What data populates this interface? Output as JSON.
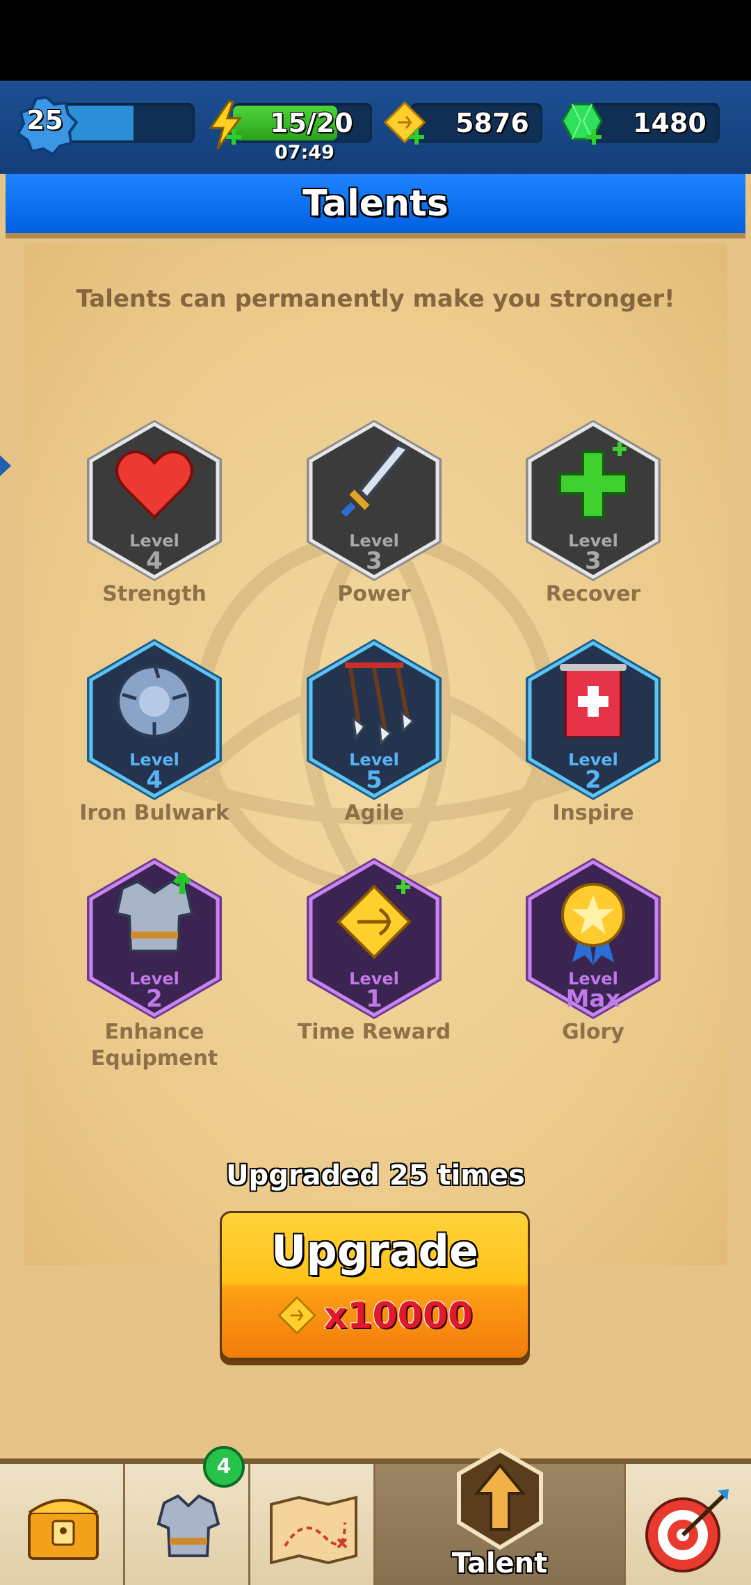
{
  "header": {
    "player_level": "25",
    "xp_fill": 0.58,
    "energy": "15/20",
    "energy_fill": 0.75,
    "energy_timer": "07:49",
    "gold": "5876",
    "gems": "1480"
  },
  "title": "Talents",
  "subtitle": "Talents can permanently make you stronger!",
  "talents": [
    {
      "name": "Strength",
      "level_label": "Level",
      "level": "4",
      "tier": "gray",
      "icon": "heart-icon"
    },
    {
      "name": "Power",
      "level_label": "Level",
      "level": "3",
      "tier": "gray",
      "icon": "sword-icon"
    },
    {
      "name": "Recover",
      "level_label": "Level",
      "level": "3",
      "tier": "gray",
      "icon": "plus-icon"
    },
    {
      "name": "Iron Bulwark",
      "level_label": "Level",
      "level": "4",
      "tier": "blue",
      "icon": "shield-icon"
    },
    {
      "name": "Agile",
      "level_label": "Level",
      "level": "5",
      "tier": "blue",
      "icon": "arrows-icon"
    },
    {
      "name": "Inspire",
      "level_label": "Level",
      "level": "2",
      "tier": "blue",
      "icon": "banner-icon"
    },
    {
      "name": "Enhance Equipment",
      "name_line1": "Enhance",
      "name_line2": "Equipment",
      "level_label": "Level",
      "level": "2",
      "tier": "purple",
      "icon": "armor-icon"
    },
    {
      "name": "Time Reward",
      "level_label": "Level",
      "level": "1",
      "tier": "purple",
      "icon": "gold-coin-icon"
    },
    {
      "name": "Glory",
      "level_label": "Level",
      "level": "Max",
      "tier": "purple",
      "icon": "medal-icon"
    }
  ],
  "upgrade": {
    "count_text": "Upgraded 25 times",
    "button_label": "Upgrade",
    "cost": "x10000"
  },
  "nav": {
    "items": [
      {
        "name": "shop",
        "icon": "treasure-chest-icon"
      },
      {
        "name": "equipment",
        "icon": "armor-icon",
        "badge": "4"
      },
      {
        "name": "map",
        "icon": "map-icon"
      },
      {
        "name": "talent",
        "icon": "arrow-up-icon",
        "label": "Talent",
        "active": true
      },
      {
        "name": "challenge",
        "icon": "target-icon"
      }
    ]
  },
  "colors": {
    "title_bar": "#0061e0",
    "panel": "#ebc98a",
    "tier_gray": "#a9a9a9",
    "tier_blue": "#58b5f5",
    "tier_purple": "#c07ae8",
    "cost_red": "#e0192c"
  }
}
